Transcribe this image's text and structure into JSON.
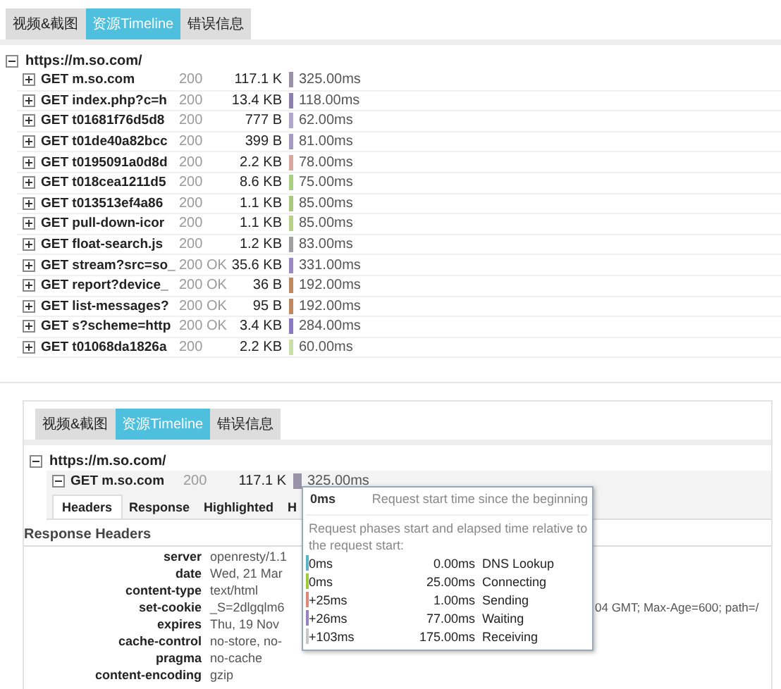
{
  "top_panel": {
    "tabs": [
      {
        "label": "视频&截图",
        "selected": false
      },
      {
        "label": "资源Timeline",
        "selected": true
      },
      {
        "label": "错误信息",
        "selected": false
      }
    ],
    "tree": {
      "label": "https://m.so.com/",
      "expanded": true,
      "rows": [
        {
          "name": "GET m.so.com",
          "status": "200",
          "size": "117.1 K",
          "time": "325.00ms",
          "color": "#9a93a8"
        },
        {
          "name": "GET index.php?c=h",
          "status": "200",
          "size": "13.4 KB",
          "time": "118.00ms",
          "color": "#8c7fb0"
        },
        {
          "name": "GET t01681f76d5d8",
          "status": "200",
          "size": "777 B",
          "time": "62.00ms",
          "color": "#b0a8cc"
        },
        {
          "name": "GET t01de40a82bcc",
          "status": "200",
          "size": "399 B",
          "time": "81.00ms",
          "color": "#a49cc0"
        },
        {
          "name": "GET t0195091a0d8d",
          "status": "200",
          "size": "2.2 KB",
          "time": "78.00ms",
          "color": "#d8a8a0"
        },
        {
          "name": "GET t018cea1211d5",
          "status": "200",
          "size": "8.6 KB",
          "time": "75.00ms",
          "color": "#a8d080"
        },
        {
          "name": "GET t013513ef4a86",
          "status": "200",
          "size": "1.1 KB",
          "time": "85.00ms",
          "color": "#a8c880"
        },
        {
          "name": "GET pull-down-icor",
          "status": "200",
          "size": "1.1 KB",
          "time": "85.00ms",
          "color": "#b8d088"
        },
        {
          "name": "GET float-search.js",
          "status": "200",
          "size": "1.2 KB",
          "time": "83.00ms",
          "color": "#a0a0a0"
        },
        {
          "name": "GET stream?src=so_",
          "status": "200 OK",
          "size": "35.6 KB",
          "time": "331.00ms",
          "color": "#9a88c0"
        },
        {
          "name": "GET report?device_",
          "status": "200 OK",
          "size": "36 B",
          "time": "192.00ms",
          "color": "#c08860"
        },
        {
          "name": "GET list-messages?",
          "status": "200 OK",
          "size": "95 B",
          "time": "192.00ms",
          "color": "#c08860"
        },
        {
          "name": "GET s?scheme=http",
          "status": "200 OK",
          "size": "3.4 KB",
          "time": "284.00ms",
          "color": "#8a78c0"
        },
        {
          "name": "GET t01068da1826a",
          "status": "200",
          "size": "2.2 KB",
          "time": "60.00ms",
          "color": "#c8e0a8"
        }
      ]
    }
  },
  "bottom_panel": {
    "tabs": [
      {
        "label": "视频&截图",
        "selected": false
      },
      {
        "label": "资源Timeline",
        "selected": true
      },
      {
        "label": "错误信息",
        "selected": false
      }
    ],
    "tree": {
      "label": "https://m.so.com/",
      "expanded": true,
      "row": {
        "name": "GET m.so.com",
        "status": "200",
        "size": "117.1 K",
        "time": "325.00ms",
        "expanded": true,
        "color": "#9a93a8"
      }
    },
    "detail_tabs": [
      {
        "label": "Headers",
        "selected": true
      },
      {
        "label": "Response",
        "selected": false
      },
      {
        "label": "Highlighted",
        "selected": false
      },
      {
        "label": "H",
        "selected": false
      }
    ],
    "section_title": "Response Headers",
    "headers": [
      {
        "key": "server",
        "value": "openresty/1.1"
      },
      {
        "key": "date",
        "value": "Wed, 21 Mar"
      },
      {
        "key": "content-type",
        "value": "text/html"
      },
      {
        "key": "set-cookie",
        "value": "_S=2dlgqlm6",
        "value_tail": "04 GMT; Max-Age=600; path=/"
      },
      {
        "key": "expires",
        "value": "Thu, 19 Nov"
      },
      {
        "key": "cache-control",
        "value": "no-store, no-"
      },
      {
        "key": "pragma",
        "value": "no-cache"
      },
      {
        "key": "content-encoding",
        "value": "gzip"
      }
    ],
    "tooltip": {
      "start": "0ms",
      "start_label": "Request start time since the beginning",
      "intro": "Request phases start and elapsed time relative to the request start:",
      "phases": [
        {
          "offset": "0ms",
          "duration": "0.00ms",
          "name": "DNS Lookup",
          "color": "#5ab4c8"
        },
        {
          "offset": "0ms",
          "duration": "25.00ms",
          "name": "Connecting",
          "color": "#9ccc3c"
        },
        {
          "offset": "+25ms",
          "duration": "1.00ms",
          "name": "Sending",
          "color": "#e08878"
        },
        {
          "offset": "+26ms",
          "duration": "77.00ms",
          "name": "Waiting",
          "color": "#9a80c0"
        },
        {
          "offset": "+103ms",
          "duration": "175.00ms",
          "name": "Receiving",
          "color": "#c8c8c8"
        }
      ]
    }
  }
}
